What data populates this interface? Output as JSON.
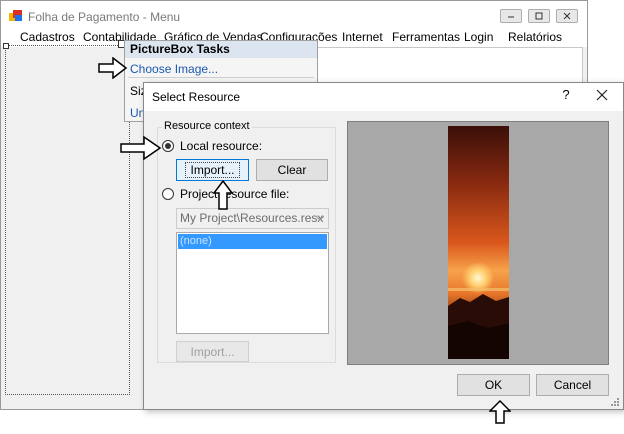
{
  "main_window": {
    "title": "Folha de Pagamento - Menu",
    "menu": [
      "Cadastros",
      "Contabilidade",
      "Gráfico de Vendas",
      "Configurações",
      "Internet",
      "Ferramentas",
      "Login",
      "Relatórios"
    ]
  },
  "picturebox_tasks": {
    "title": "PictureBox Tasks",
    "choose_image": "Choose Image...",
    "size_mode_partial": "Siz",
    "undock_partial": "Un"
  },
  "dialog": {
    "title": "Select Resource",
    "help": "?",
    "group_label": "Resource context",
    "local_resource": "Local resource:",
    "import_button": "Import...",
    "clear_button": "Clear",
    "project_resource_file": "Project resource file:",
    "combo_value": "My Project\\Resources.resx",
    "list_items": [
      "(none)"
    ],
    "import_button_disabled": "Import...",
    "ok_button": "OK",
    "cancel_button": "Cancel"
  },
  "colors": {
    "accent": "#0078d7",
    "link": "#1b59b0",
    "selection": "#3399ff",
    "preview_bg": "#a8a8a8"
  }
}
